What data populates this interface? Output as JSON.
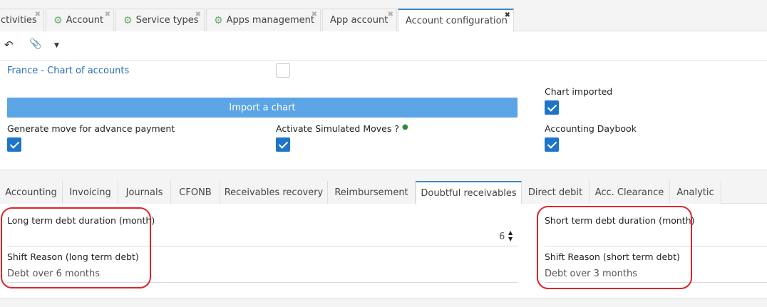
{
  "tabs": [
    {
      "label": "ctivities",
      "icon": "",
      "active": false
    },
    {
      "label": "Account",
      "icon": "gear-icon",
      "active": false
    },
    {
      "label": "Service types",
      "icon": "gear-icon",
      "active": false
    },
    {
      "label": "Apps management",
      "icon": "gear-icon",
      "active": false
    },
    {
      "label": "App account",
      "icon": "",
      "active": false
    },
    {
      "label": "Account configuration",
      "icon": "",
      "active": true
    }
  ],
  "toolbar": {
    "icons": [
      "undo-icon",
      "attachment-icon",
      "dropdown-caret-icon"
    ]
  },
  "form": {
    "chart_link": "France - Chart of accounts",
    "chart_link_checkbox": false,
    "chart_imported_label": "Chart imported",
    "chart_imported": true,
    "import_button": "Import a chart",
    "advance_payment_label": "Generate move for advance payment",
    "advance_payment": true,
    "simulated_moves_label": "Activate Simulated Moves ?",
    "simulated_moves": true,
    "daybook_label": "Accounting Daybook",
    "daybook": true
  },
  "subtabs": [
    "Accounting",
    "Invoicing",
    "Journals",
    "CFONB",
    "Receivables recovery",
    "Reimbursement",
    "Doubtful receivables",
    "Direct debit",
    "Acc. Clearance",
    "Analytic"
  ],
  "active_subtab": "Doubtful receivables",
  "doubtful": {
    "long_label": "Long term debt duration (month)",
    "long_value": "6",
    "long_reason_label": "Shift Reason (long term debt)",
    "long_reason": "Debt over 6 months",
    "short_label": "Short term debt duration (month)",
    "short_value": "",
    "short_reason_label": "Shift Reason (short term debt)",
    "short_reason": "Debt over 3 months"
  },
  "colors": {
    "accent": "#1e74c8",
    "button": "#5ba4e5",
    "highlight": "#e0242c",
    "link": "#2a6fb8"
  }
}
